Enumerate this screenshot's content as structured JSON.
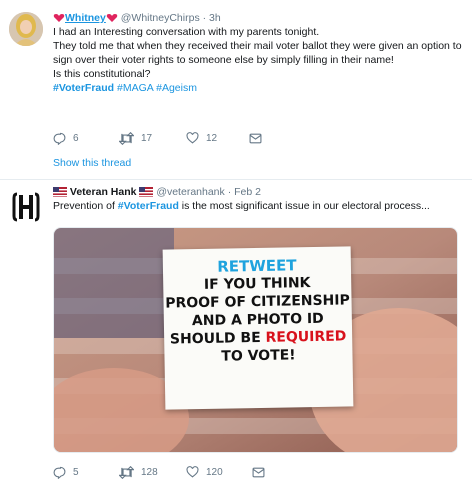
{
  "tweet1": {
    "name": "Whitney",
    "handle": "@WhitneyChirps",
    "time": "3h",
    "lines": [
      "I had an Interesting conversation with my parents tonight.",
      "They told me that when they received their mail voter ballot they were given an option to sign over their voter rights to someone else by simply filling in their name!",
      "Is this constitutional?"
    ],
    "hashtags": [
      "#VoterFraud",
      "#MAGA",
      "#Ageism"
    ],
    "reply_count": "6",
    "retweet_count": "17",
    "like_count": "12",
    "show_thread": "Show this thread"
  },
  "tweet2": {
    "name": "Veteran Hank",
    "handle": "@veteranhank",
    "time": "Feb 2",
    "text_before": "Prevention of ",
    "hashtag": "#VoterFraud",
    "text_after": " is the most significant issue in our electoral process...",
    "reply_count": "5",
    "retweet_count": "128",
    "like_count": "120",
    "image_text": {
      "line1": "RETWEET",
      "line2": "IF YOU THINK",
      "line3": "PROOF OF CITIZENSHIP",
      "line4": "AND A PHOTO ID",
      "line5a": "SHOULD BE ",
      "line5b": "REQUIRED",
      "line6": "TO VOTE!"
    }
  },
  "colors": {
    "link": "#1b95e0",
    "muted": "#657786",
    "retweet_blue": "#1fa3de",
    "required_red": "#d8121c"
  },
  "icons": [
    "reply-icon",
    "retweet-icon",
    "like-icon",
    "dm-icon",
    "flag-icon",
    "heart-emoji-icon"
  ]
}
